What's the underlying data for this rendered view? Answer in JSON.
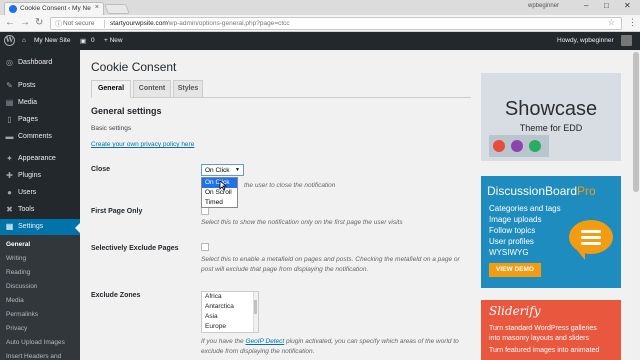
{
  "browser": {
    "tab_title": "Cookie Consent ‹ My Ne",
    "tab_close": "×",
    "user": "wpbeginner",
    "minimize": "–",
    "maximize": "□",
    "close": "✕",
    "back": "←",
    "forward": "→",
    "reload": "↻",
    "lock": "ⓘ",
    "not_secure": "Not secure",
    "url_host": "startyourwpsite.com",
    "url_path": "/wp-admin/options-general.php?page=ctcc",
    "star": "☆",
    "menu": "⋮"
  },
  "adminbar": {
    "logo": "W",
    "site_icon": "⌂",
    "site": "My New Site",
    "comments_icon": "▣",
    "comments": "0",
    "new": "+ New",
    "howdy": "Howdy, wpbeginner"
  },
  "sidebar": {
    "items": [
      {
        "label": "Dashboard",
        "icon": "◎"
      },
      {
        "label": "Posts",
        "icon": "✎"
      },
      {
        "label": "Media",
        "icon": "▤"
      },
      {
        "label": "Pages",
        "icon": "▯"
      },
      {
        "label": "Comments",
        "icon": "▬"
      },
      {
        "label": "Appearance",
        "icon": "✦"
      },
      {
        "label": "Plugins",
        "icon": "✚"
      },
      {
        "label": "Users",
        "icon": "●"
      },
      {
        "label": "Tools",
        "icon": "✖"
      },
      {
        "label": "Settings",
        "icon": "▦"
      }
    ],
    "submenu": [
      "General",
      "Writing",
      "Reading",
      "Discussion",
      "Media",
      "Permalinks",
      "Privacy",
      "Auto Upload Images",
      "Insert Headers and"
    ]
  },
  "main": {
    "title": "Cookie Consent",
    "tabs": [
      "General",
      "Content",
      "Styles"
    ],
    "section": "General settings",
    "basic": "Basic settings",
    "privacy_link": "Create your own privacy policy here",
    "close_label": "Close",
    "close_value": "On Click",
    "close_arrow": "▼",
    "close_options": [
      "On Click",
      "On Scroll",
      "Timed"
    ],
    "close_desc": "the user to close the notification",
    "first_page_label": "First Page Only",
    "first_page_desc": "Select this to show the notification only on the first page the user visits",
    "exclude_pages_label": "Selectively Exclude Pages",
    "exclude_pages_desc": "Select this to enable a metafield on pages and posts. Checking the metafield on a page or post will exclude that page from displaying the notification.",
    "exclude_zones_label": "Exclude Zones",
    "zones": [
      "Africa",
      "Antarctica",
      "Asia",
      "Europe"
    ],
    "zones_desc_pre": "If you have the",
    "zones_desc_link": "GeoIP Detect",
    "zones_desc_post": "plugin activated, you can specify which areas of the world to exclude from displaying the notification."
  },
  "ads": {
    "showcase_title": "Showcase",
    "showcase_sub": "Theme for EDD",
    "dbp_title": "DiscussionBoard",
    "dbp_title_accent": "Pro",
    "dbp_lines": [
      "Categories and tags",
      "Image uploads",
      "Follow topics",
      "User profiles",
      "WYSIWYG"
    ],
    "dbp_button": "VIEW DEMO",
    "sliderify_title": "Sliderify",
    "sliderify_lines": [
      "Turn standard WordPress galleries",
      "into masonry layouts and sliders",
      "Turn featured images into animated"
    ]
  }
}
